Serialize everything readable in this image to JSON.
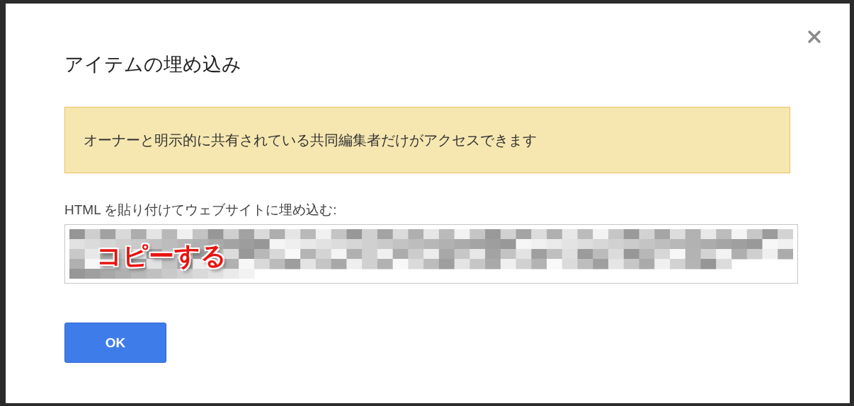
{
  "dialog": {
    "title": "アイテムの埋め込み",
    "notice": "オーナーと明示的に共有されている共同編集者だけがアクセスできます",
    "embed_label": "HTML を貼り付けてウェブサイトに埋め込む:",
    "annotation": "コピーする",
    "ok_button": "OK"
  }
}
